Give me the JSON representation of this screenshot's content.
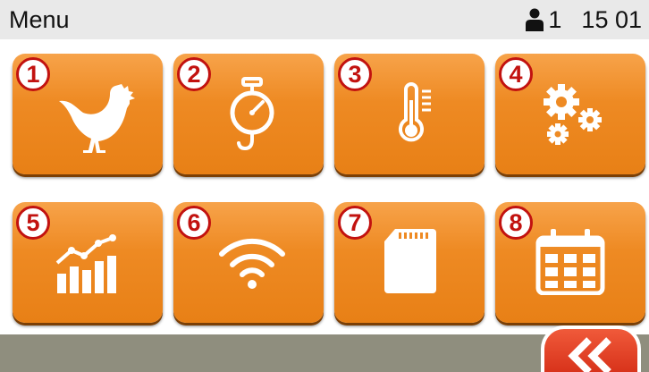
{
  "header": {
    "title": "Menu",
    "user_count": "1",
    "time": "15 01"
  },
  "tiles": [
    {
      "number": "1",
      "icon": "rooster-icon"
    },
    {
      "number": "2",
      "icon": "hanging-scale-icon"
    },
    {
      "number": "3",
      "icon": "thermometer-icon"
    },
    {
      "number": "4",
      "icon": "gears-icon"
    },
    {
      "number": "5",
      "icon": "growth-chart-icon"
    },
    {
      "number": "6",
      "icon": "wifi-icon"
    },
    {
      "number": "7",
      "icon": "sd-card-icon"
    },
    {
      "number": "8",
      "icon": "calendar-icon"
    }
  ],
  "footer": {
    "back_icon": "double-chevron-left-icon"
  },
  "colors": {
    "tile": "#ee8a23",
    "badge_border": "#c2120f",
    "back_button": "#e2432a",
    "bottom_bar": "#8f8e7e",
    "top_bar": "#e9e9e9"
  }
}
